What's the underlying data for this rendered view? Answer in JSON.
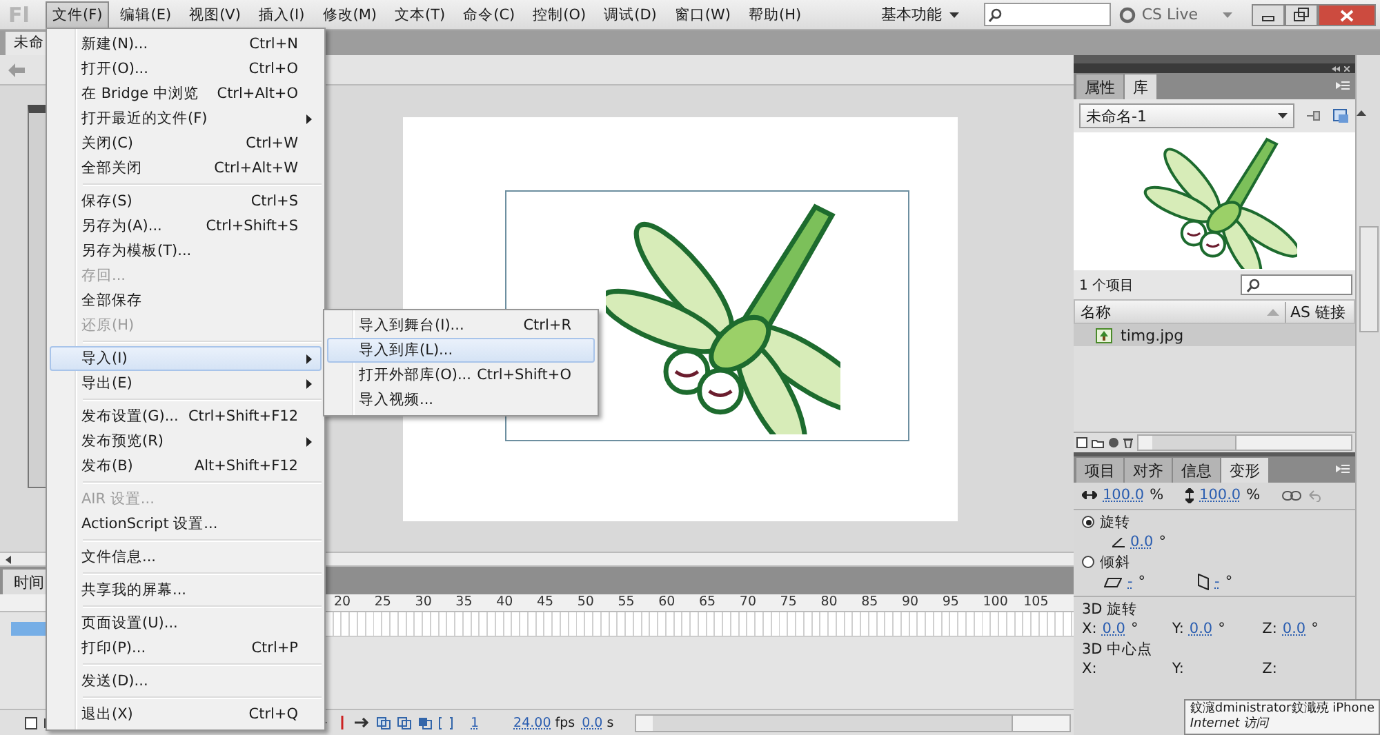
{
  "menubar": {
    "logo": "Fl",
    "menus": [
      {
        "label": "文件(F)",
        "selected": true
      },
      {
        "label": "编辑(E)",
        "selected": false
      },
      {
        "label": "视图(V)",
        "selected": false
      },
      {
        "label": "插入(I)",
        "selected": false
      },
      {
        "label": "修改(M)",
        "selected": false
      },
      {
        "label": "文本(T)",
        "selected": false
      },
      {
        "label": "命令(C)",
        "selected": false
      },
      {
        "label": "控制(O)",
        "selected": false
      },
      {
        "label": "调试(D)",
        "selected": false
      },
      {
        "label": "窗口(W)",
        "selected": false
      },
      {
        "label": "帮助(H)",
        "selected": false
      }
    ],
    "workspace": "基本功能",
    "cs_live": "CS Live"
  },
  "document_tab": {
    "title": "未命"
  },
  "file_menu": {
    "items": [
      {
        "kind": "item",
        "label": "新建(N)...",
        "shortcut": "Ctrl+N",
        "submenu": false,
        "disabled": false,
        "selected": false
      },
      {
        "kind": "item",
        "label": "打开(O)...",
        "shortcut": "Ctrl+O",
        "submenu": false,
        "disabled": false,
        "selected": false
      },
      {
        "kind": "item",
        "label": "在 Bridge 中浏览",
        "shortcut": "Ctrl+Alt+O",
        "submenu": false,
        "disabled": false,
        "selected": false
      },
      {
        "kind": "item",
        "label": "打开最近的文件(F)",
        "submenu": true,
        "disabled": false,
        "selected": false
      },
      {
        "kind": "item",
        "label": "关闭(C)",
        "shortcut": "Ctrl+W",
        "submenu": false,
        "disabled": false,
        "selected": false
      },
      {
        "kind": "item",
        "label": "全部关闭",
        "shortcut": "Ctrl+Alt+W",
        "submenu": false,
        "disabled": false,
        "selected": false
      },
      {
        "kind": "separator"
      },
      {
        "kind": "item",
        "label": "保存(S)",
        "shortcut": "Ctrl+S",
        "submenu": false,
        "disabled": false,
        "selected": false
      },
      {
        "kind": "item",
        "label": "另存为(A)...",
        "shortcut": "Ctrl+Shift+S",
        "submenu": false,
        "disabled": false,
        "selected": false
      },
      {
        "kind": "item",
        "label": "另存为模板(T)...",
        "submenu": false,
        "disabled": false,
        "selected": false
      },
      {
        "kind": "item",
        "label": "存回...",
        "submenu": false,
        "disabled": true,
        "selected": false
      },
      {
        "kind": "item",
        "label": "全部保存",
        "submenu": false,
        "disabled": false,
        "selected": false
      },
      {
        "kind": "item",
        "label": "还原(H)",
        "submenu": false,
        "disabled": true,
        "selected": false
      },
      {
        "kind": "separator"
      },
      {
        "kind": "item",
        "label": "导入(I)",
        "submenu": true,
        "disabled": false,
        "selected": true
      },
      {
        "kind": "item",
        "label": "导出(E)",
        "submenu": true,
        "disabled": false,
        "selected": false
      },
      {
        "kind": "separator"
      },
      {
        "kind": "item",
        "label": "发布设置(G)...",
        "shortcut": "Ctrl+Shift+F12",
        "submenu": false,
        "disabled": false,
        "selected": false
      },
      {
        "kind": "item",
        "label": "发布预览(R)",
        "submenu": true,
        "disabled": false,
        "selected": false
      },
      {
        "kind": "item",
        "label": "发布(B)",
        "shortcut": "Alt+Shift+F12",
        "submenu": false,
        "disabled": false,
        "selected": false
      },
      {
        "kind": "separator"
      },
      {
        "kind": "item",
        "label": "AIR 设置...",
        "submenu": false,
        "disabled": true,
        "selected": false
      },
      {
        "kind": "item",
        "label": "ActionScript 设置...",
        "submenu": false,
        "disabled": false,
        "selected": false
      },
      {
        "kind": "separator"
      },
      {
        "kind": "item",
        "label": "文件信息...",
        "submenu": false,
        "disabled": false,
        "selected": false
      },
      {
        "kind": "separator"
      },
      {
        "kind": "item",
        "label": "共享我的屏幕...",
        "submenu": false,
        "disabled": false,
        "selected": false
      },
      {
        "kind": "separator"
      },
      {
        "kind": "item",
        "label": "页面设置(U)...",
        "submenu": false,
        "disabled": false,
        "selected": false
      },
      {
        "kind": "item",
        "label": "打印(P)...",
        "shortcut": "Ctrl+P",
        "submenu": false,
        "disabled": false,
        "selected": false
      },
      {
        "kind": "separator"
      },
      {
        "kind": "item",
        "label": "发送(D)...",
        "submenu": false,
        "disabled": false,
        "selected": false
      },
      {
        "kind": "separator"
      },
      {
        "kind": "item",
        "label": "退出(X)",
        "shortcut": "Ctrl+Q",
        "submenu": false,
        "disabled": false,
        "selected": false
      }
    ]
  },
  "import_submenu": {
    "items": [
      {
        "label": "导入到舞台(I)...",
        "shortcut": "Ctrl+R",
        "selected": false
      },
      {
        "label": "导入到库(L)...",
        "selected": true
      },
      {
        "label": "打开外部库(O)...",
        "shortcut": "Ctrl+Shift+O",
        "selected": false
      },
      {
        "label": "导入视频...",
        "selected": false
      }
    ]
  },
  "timeline": {
    "tab": "时间",
    "frame_numbers": [
      "20",
      "25",
      "30",
      "35",
      "40",
      "45",
      "50",
      "55",
      "60",
      "65",
      "70",
      "75",
      "80",
      "85",
      "90",
      "95",
      "100",
      "105"
    ],
    "layers": [
      {
        "selected": true
      }
    ],
    "current_frame": "1",
    "fps": "24.00",
    "fps_unit": "fps",
    "time": "0.0",
    "time_unit": "s"
  },
  "library_panel": {
    "tabs": [
      {
        "label": "属性",
        "selected": false
      },
      {
        "label": "库",
        "selected": true
      }
    ],
    "document": "未命名-1",
    "item_count": "1 个项目",
    "columns": [
      "名称",
      "AS 链接"
    ],
    "items": [
      {
        "name": "timg.jpg",
        "selected": true
      }
    ]
  },
  "transform_panel": {
    "tabs": [
      {
        "label": "项目",
        "selected": false
      },
      {
        "label": "对齐",
        "selected": false
      },
      {
        "label": "信息",
        "selected": false
      },
      {
        "label": "变形",
        "selected": true
      }
    ],
    "scale": [
      {
        "value": "100.0",
        "unit": "%"
      },
      {
        "value": "100.0",
        "unit": "%"
      }
    ],
    "options": [
      {
        "label": "旋转",
        "selected": true
      },
      {
        "label": "倾斜",
        "selected": false
      }
    ],
    "rotation": {
      "value": "0.0",
      "unit": "°"
    },
    "skew": [
      {
        "value": "-",
        "unit": "°"
      },
      {
        "value": "-",
        "unit": "°"
      }
    ],
    "rotation_3d": {
      "title": "3D 旋转",
      "axes": [
        {
          "label": "X:",
          "value": "0.0",
          "unit": "°"
        },
        {
          "label": "Y:",
          "value": "0.0",
          "unit": "°"
        },
        {
          "label": "Z:",
          "value": "0.0",
          "unit": "°"
        }
      ]
    },
    "center_3d": {
      "title": "3D 中心点",
      "axes": [
        {
          "label": "X:"
        },
        {
          "label": "Y:"
        },
        {
          "label": "Z:"
        }
      ]
    }
  },
  "tooltip": {
    "title": "鈫滱dministrator鈫濈殑 iPhone",
    "subtitle": "Internet 访问"
  }
}
